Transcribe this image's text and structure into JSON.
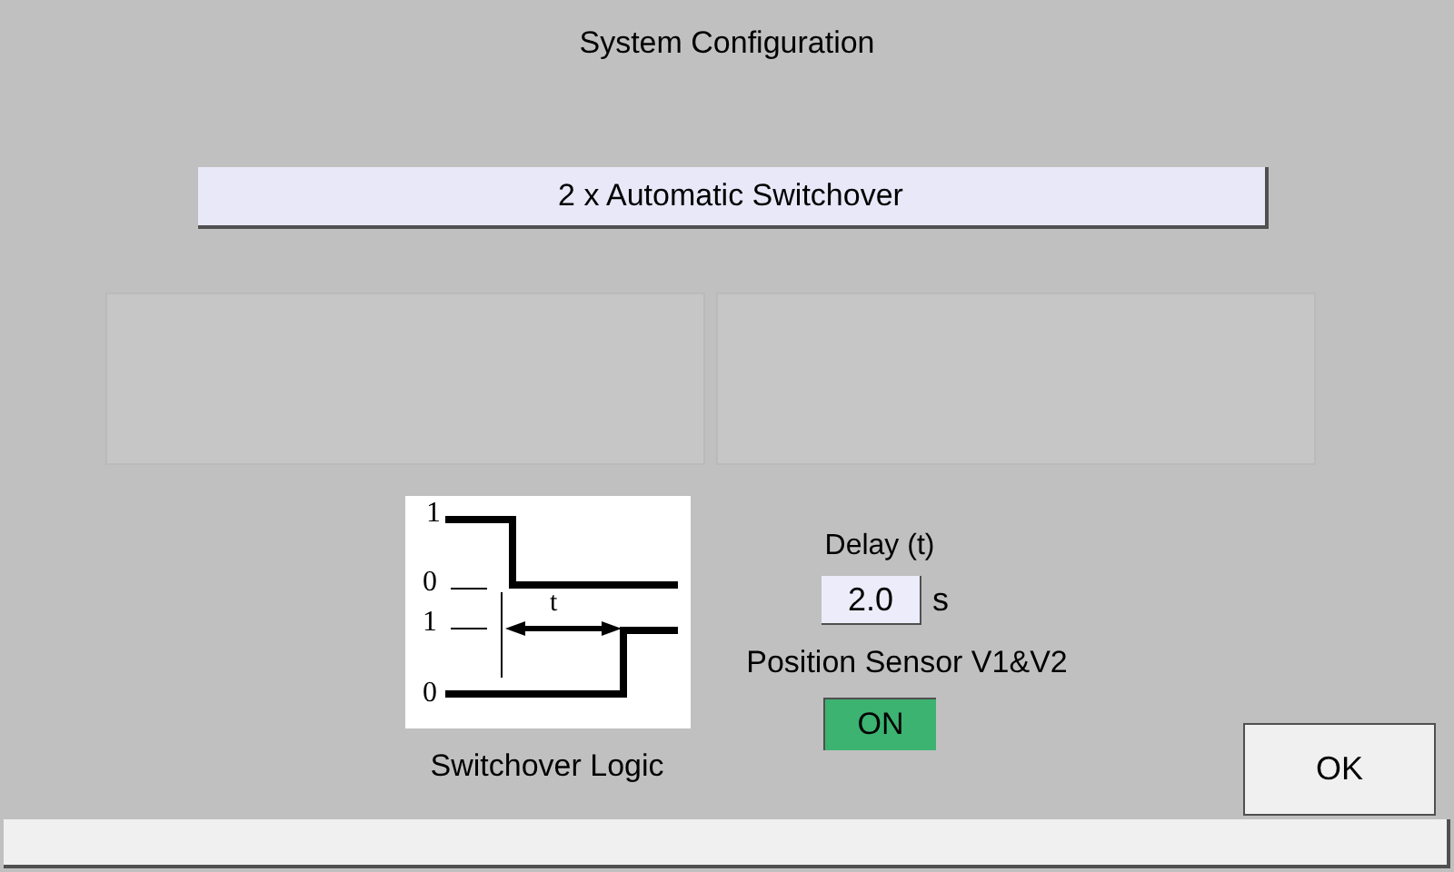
{
  "window": {
    "title": "System Configuration"
  },
  "mode_selector": {
    "value": "2 x Automatic Switchover"
  },
  "panels": [
    {
      "kind": "empty"
    },
    {
      "kind": "empty"
    }
  ],
  "switchover_diagram": {
    "level_labels": [
      "1",
      "0",
      "1",
      "0"
    ],
    "delay_label": "t",
    "caption": "Switchover Logic"
  },
  "delay": {
    "label": "Delay (t)",
    "value": "2.0",
    "unit": "s"
  },
  "position_sensor": {
    "label": "Position Sensor V1&V2",
    "toggle": {
      "text": "ON",
      "on": true
    }
  },
  "buttons": [
    {
      "label": "OK"
    }
  ],
  "status_bar": {
    "kind": "empty"
  }
}
